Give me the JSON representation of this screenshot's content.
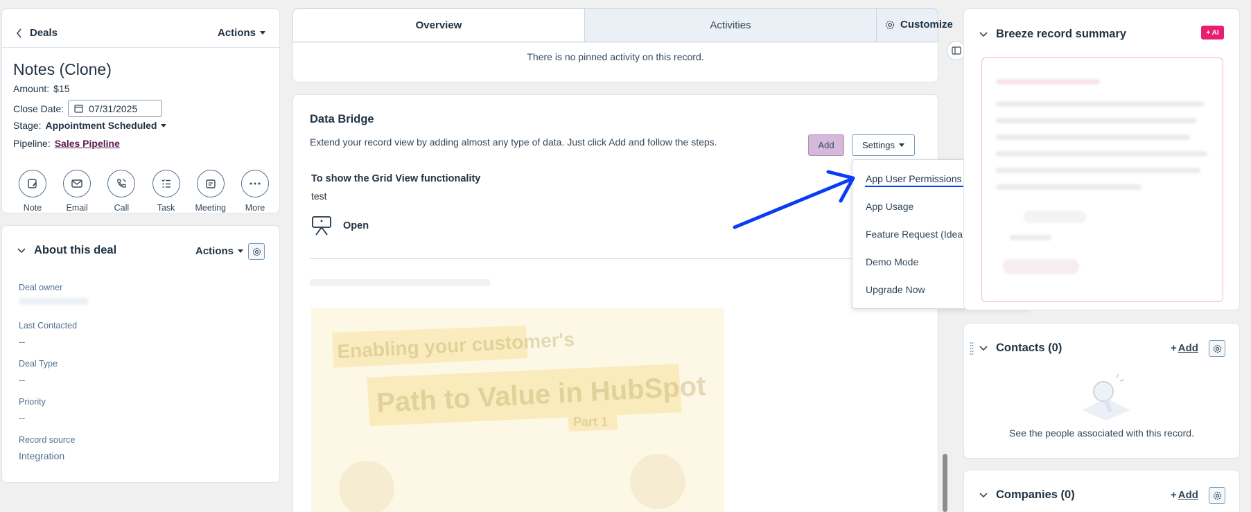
{
  "left": {
    "back_label": "Deals",
    "actions_label": "Actions",
    "record_title": "Notes (Clone)",
    "amount_label": "Amount:",
    "amount_value": "$15",
    "close_date_label": "Close Date:",
    "close_date_value": "07/31/2025",
    "stage_label": "Stage:",
    "stage_value": "Appointment Scheduled",
    "pipeline_label": "Pipeline:",
    "pipeline_value": "Sales Pipeline",
    "quick_actions": [
      {
        "label": "Note",
        "icon": "note-icon"
      },
      {
        "label": "Email",
        "icon": "email-icon"
      },
      {
        "label": "Call",
        "icon": "call-icon"
      },
      {
        "label": "Task",
        "icon": "task-icon"
      },
      {
        "label": "Meeting",
        "icon": "meeting-icon"
      },
      {
        "label": "More",
        "icon": "more-icon"
      }
    ]
  },
  "about": {
    "title": "About this deal",
    "actions_label": "Actions",
    "properties": [
      {
        "label": "Deal owner",
        "value": ""
      },
      {
        "label": "Last Contacted",
        "value": "--"
      },
      {
        "label": "Deal Type",
        "value": "--"
      },
      {
        "label": "Priority",
        "value": "--"
      },
      {
        "label": "Record source",
        "value": "Integration"
      }
    ]
  },
  "tabs": [
    {
      "label": "Overview",
      "active": true
    },
    {
      "label": "Activities",
      "active": false
    }
  ],
  "customize_label": "Customize",
  "pinned_text": "There is no pinned activity on this record.",
  "bridge": {
    "title": "Data Bridge",
    "description": "Extend your record view by adding almost any type of data. Just click Add and follow the steps.",
    "add_label": "Add",
    "settings_label": "Settings",
    "grid_title": "To show the Grid View functionality",
    "grid_sub": "test",
    "open_label": "Open",
    "video_title_1": "Enabling your customer's",
    "video_title_2": "Path to Value in HubSpot",
    "video_part": "Part 1"
  },
  "dropdown": {
    "items": [
      "App User Permissions",
      "App Usage",
      "Feature Request (Idea Portal)",
      "Demo Mode",
      "Upgrade Now"
    ]
  },
  "breeze": {
    "title": "Breeze record summary",
    "badge": "+ AI"
  },
  "contacts": {
    "title": "Contacts (0)",
    "add_label": "Add",
    "empty_text": "See the people associated with this record."
  },
  "companies": {
    "title": "Companies (0)",
    "add_label": "Add"
  },
  "colors": {
    "accent_purple": "#5c1a4e",
    "add_button_bg": "#d6b9da",
    "ai_badge": "#ea1e6f",
    "annotation_arrow": "#0a3cf5"
  }
}
